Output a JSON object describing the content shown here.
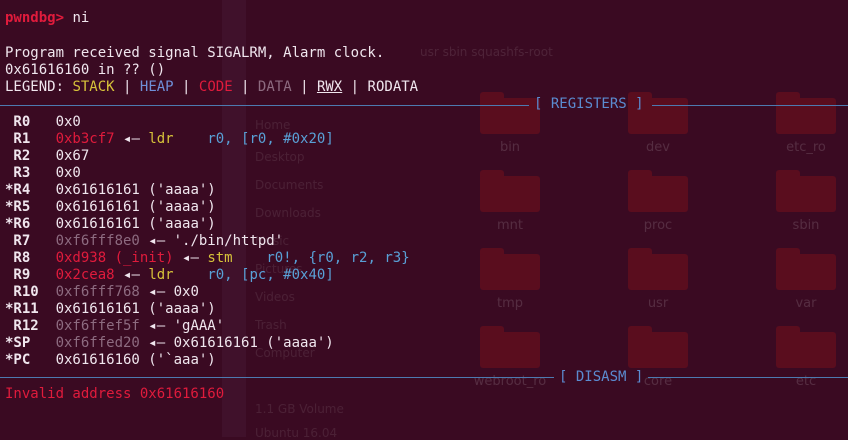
{
  "background": {
    "path_crumbs": "usr   sbin   squashfs-root",
    "sidebar": [
      "Home",
      "Desktop",
      "Documents",
      "Downloads",
      "Music",
      "Pictures",
      "Videos",
      "Trash",
      "Computer",
      "1.1 GB Volume",
      "Ubuntu 16.04"
    ],
    "folders": [
      "bin",
      "dev",
      "etc_ro",
      "mnt",
      "proc",
      "sbin",
      "tmp",
      "usr",
      "var",
      "webroot_ro",
      "core",
      "etc"
    ]
  },
  "terminal": {
    "prompt": "pwndbg>",
    "command": " ni",
    "signal_line": "Program received signal SIGALRM, Alarm clock.",
    "location_line": "0x61616160 in ?? ()",
    "legend": {
      "prefix": "LEGEND: ",
      "stack": "STACK",
      "heap": "HEAP",
      "code": "CODE",
      "data": "DATA",
      "rwx": "RWX",
      "rodata": "RODATA",
      "sep": " | "
    },
    "registers_header": "[ REGISTERS ]",
    "disasm_header": "[ DISASM ]",
    "registers": [
      {
        "name": " R0 ",
        "value": "0x0"
      },
      {
        "name": " R1 ",
        "value": "0xb3cf7",
        "arrow": " ◂— ",
        "mnemonic": "ldr",
        "operands": "r0, [r0, #0x20]"
      },
      {
        "name": " R2 ",
        "value": "0x67"
      },
      {
        "name": " R3 ",
        "value": "0x0"
      },
      {
        "name": "*R4 ",
        "value": "0x61616161 ('aaaa')"
      },
      {
        "name": "*R5 ",
        "value": "0x61616161 ('aaaa')"
      },
      {
        "name": "*R6 ",
        "value": "0x61616161 ('aaaa')"
      },
      {
        "name": " R7 ",
        "value": "0xf6fff8e0",
        "arrow": " ◂— ",
        "rest": "'./bin/httpd'"
      },
      {
        "name": " R8 ",
        "value": "0xd938 (_init)",
        "arrow": " ◂— ",
        "mnemonic": "stm",
        "operands": "r0!, {r0, r2, r3}"
      },
      {
        "name": " R9 ",
        "value": "0x2cea8",
        "arrow": " ◂— ",
        "mnemonic": "ldr",
        "operands": "r0, [pc, #0x40]"
      },
      {
        "name": " R10",
        "value": "0xf6fff768",
        "arrow": " ◂— ",
        "rest": "0x0"
      },
      {
        "name": "*R11",
        "value": "0x61616161 ('aaaa')"
      },
      {
        "name": " R12",
        "value": "0xf6ffef5f",
        "arrow": " ◂— ",
        "rest": "'gAAA'"
      },
      {
        "name": "*SP ",
        "value": "0xf6ffed20",
        "arrow": " ◂— ",
        "rest": "0x61616161 ('aaaa')"
      },
      {
        "name": "*PC ",
        "value": "0x61616160 ('`aaa')"
      }
    ],
    "error": "Invalid address 0x61616160"
  }
}
